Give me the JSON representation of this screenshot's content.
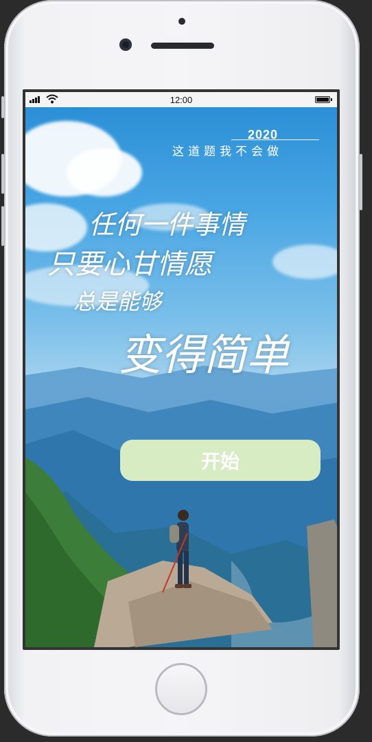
{
  "status_bar": {
    "time": "12:00"
  },
  "header": {
    "year": "2020",
    "subtitle": "这道题我不会做"
  },
  "slogan": {
    "line1": "任何一件事情",
    "line2": "只要心甘情愿",
    "line3": "总是能够",
    "line4": "变得简单",
    "line4_small": "简"
  },
  "start_button": {
    "label": "开始"
  },
  "colors": {
    "button_bg": "#d8ecc4",
    "sky": "#47a5e3",
    "frame": "#f5f5f7"
  }
}
